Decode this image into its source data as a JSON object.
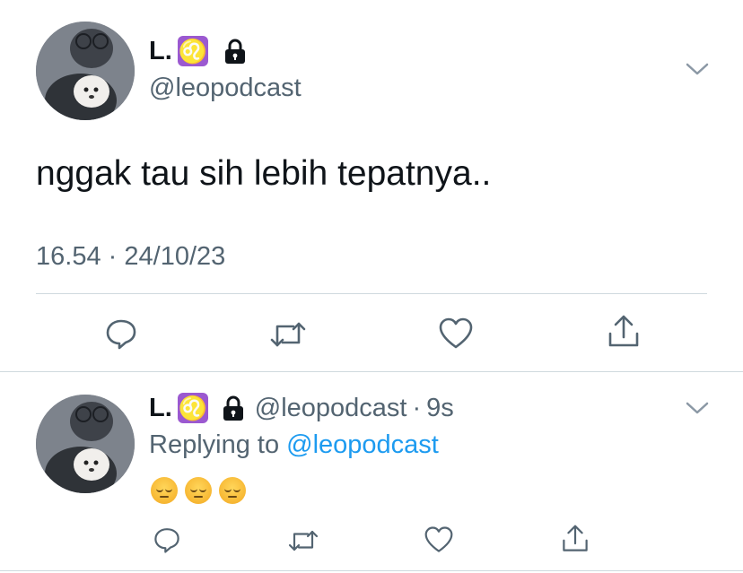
{
  "main_tweet": {
    "display_name": "L.",
    "zodiac": "♌",
    "handle": "@leopodcast",
    "text": "nggak tau sih lebih tepatnya..",
    "time": "16.54",
    "separator": "·",
    "date": "24/10/23"
  },
  "reply_tweet": {
    "display_name": "L.",
    "zodiac": "♌",
    "handle": "@leopodcast",
    "separator": "·",
    "age": "9s",
    "replying_prefix": "Replying to",
    "replying_handle": "@leopodcast",
    "emoji_count": 3
  },
  "icons": [
    "avatar",
    "leo-zodiac-icon",
    "lock-icon",
    "chevron-down-icon",
    "reply-icon",
    "retweet-icon",
    "like-icon",
    "share-icon"
  ],
  "colors": {
    "text_primary": "#0f1419",
    "text_secondary": "#536471",
    "link": "#1d9bf0",
    "divider": "#cfd9de",
    "zodiac_badge": "#9b59d0"
  }
}
